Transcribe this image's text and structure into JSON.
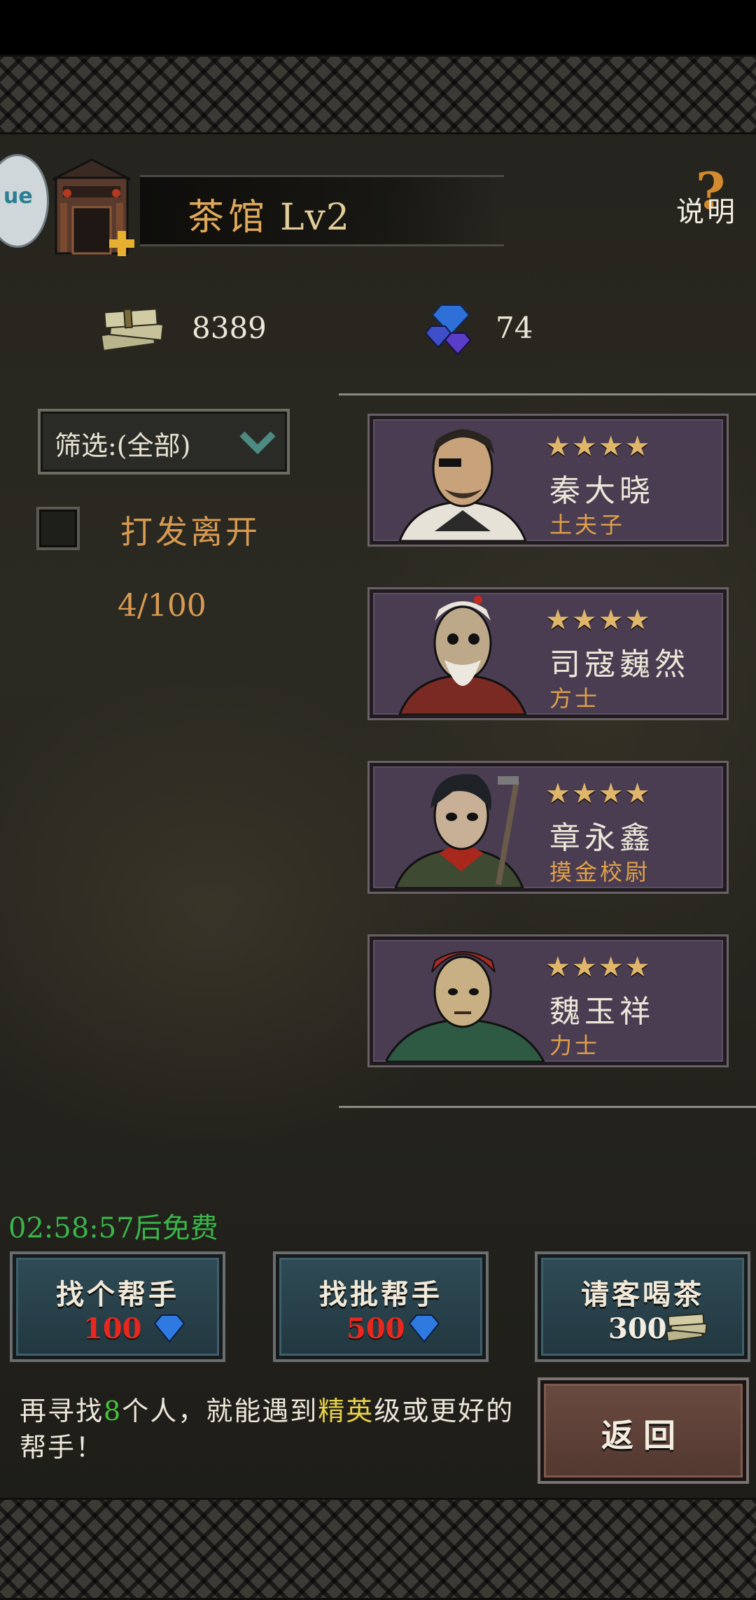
{
  "header": {
    "building_name": "茶馆",
    "level": "Lv2",
    "help_label": "说明",
    "help_glyph": "?"
  },
  "logo_text": "ue",
  "resources": {
    "money": "8389",
    "gems": "74"
  },
  "filter": {
    "label": "筛选:(全部)"
  },
  "dismiss": {
    "label": "打发离开",
    "count": "4/100"
  },
  "helpers": [
    {
      "stars": "★★★★",
      "name": "秦大晓",
      "class": "土夫子"
    },
    {
      "stars": "★★★★",
      "name": "司寇巍然",
      "class": "方士"
    },
    {
      "stars": "★★★★",
      "name": "章永鑫",
      "class": "摸金校尉"
    },
    {
      "stars": "★★★★",
      "name": "魏玉祥",
      "class": "力士"
    }
  ],
  "timer": "02:58:57后免费",
  "actions": {
    "find_one": {
      "label": "找个帮手",
      "cost": "100"
    },
    "find_batch": {
      "label": "找批帮手",
      "cost": "500"
    },
    "treat_tea": {
      "label": "请客喝茶",
      "cost": "300"
    }
  },
  "hint": {
    "part1": "再寻找",
    "number": "8",
    "part2": "个人，就能遇到",
    "rank": "精英",
    "part3": "级或更好的帮手！"
  },
  "back_label": "返回",
  "colors": {
    "accent_orange": "#d89a52",
    "timer_green": "#39b54a",
    "cost_red": "#e8281e",
    "card_purple": "#4a3d52"
  },
  "icons": {
    "money": "money-stack-icon",
    "gem": "gem-icon",
    "filter_chevron": "chevron-down-icon",
    "help": "question-mark-icon"
  }
}
